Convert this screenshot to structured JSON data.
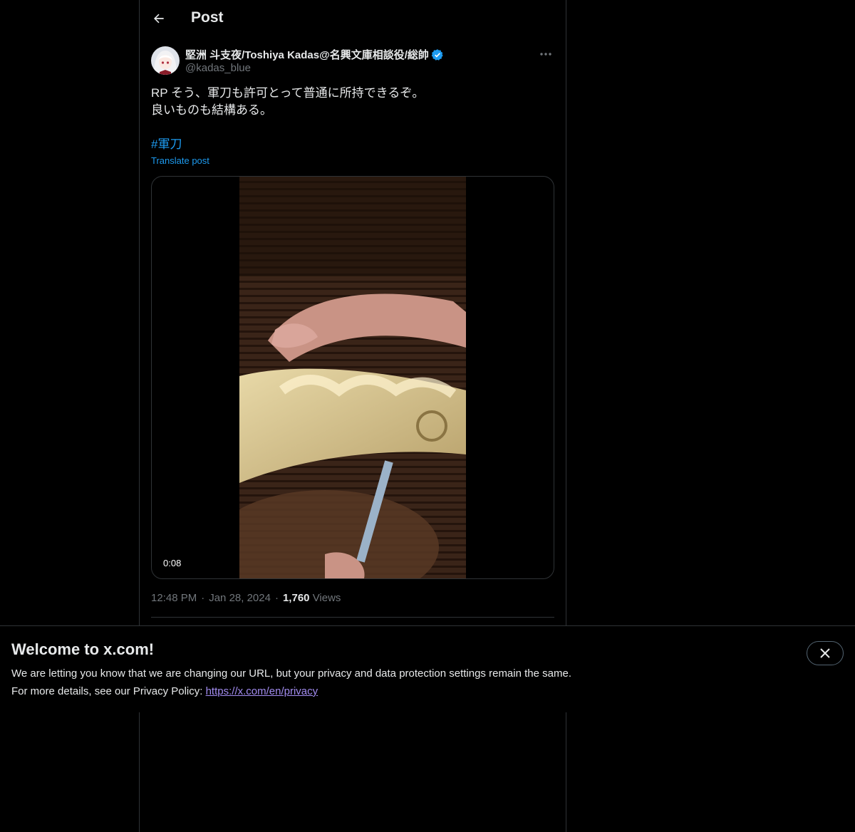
{
  "header": {
    "title": "Post",
    "back_icon": "arrow-left-icon"
  },
  "author": {
    "display_name": "堅洲 斗支夜/Toshiya Kadas@名興文庫相談役/総帥",
    "handle": "@kadas_blue",
    "verified_color": "#1d9bf0",
    "more_icon": "more-horizontal-icon"
  },
  "post": {
    "line1": "RP そう、軍刀も許可とって普通に所持できるぞ。",
    "line2": "良いものも結構ある。",
    "hashtag": "#軍刀",
    "translate_label": "Translate post",
    "video_duration": "0:08",
    "time": "12:48 PM",
    "date": "Jan 28, 2024",
    "views_count": "1,760",
    "views_label": "Views"
  },
  "banner": {
    "title": "Welcome to x.com!",
    "line1": "We are letting you know that we are changing our URL, but your privacy and data protection settings remain the same.",
    "line2_prefix": "For more details, see our Privacy Policy: ",
    "privacy_link": "https://x.com/en/privacy",
    "close_icon": "close-icon"
  },
  "colors": {
    "background": "#000000",
    "accent": "#1d9bf0",
    "link_visited": "#a28cf0",
    "muted": "#71767b"
  }
}
